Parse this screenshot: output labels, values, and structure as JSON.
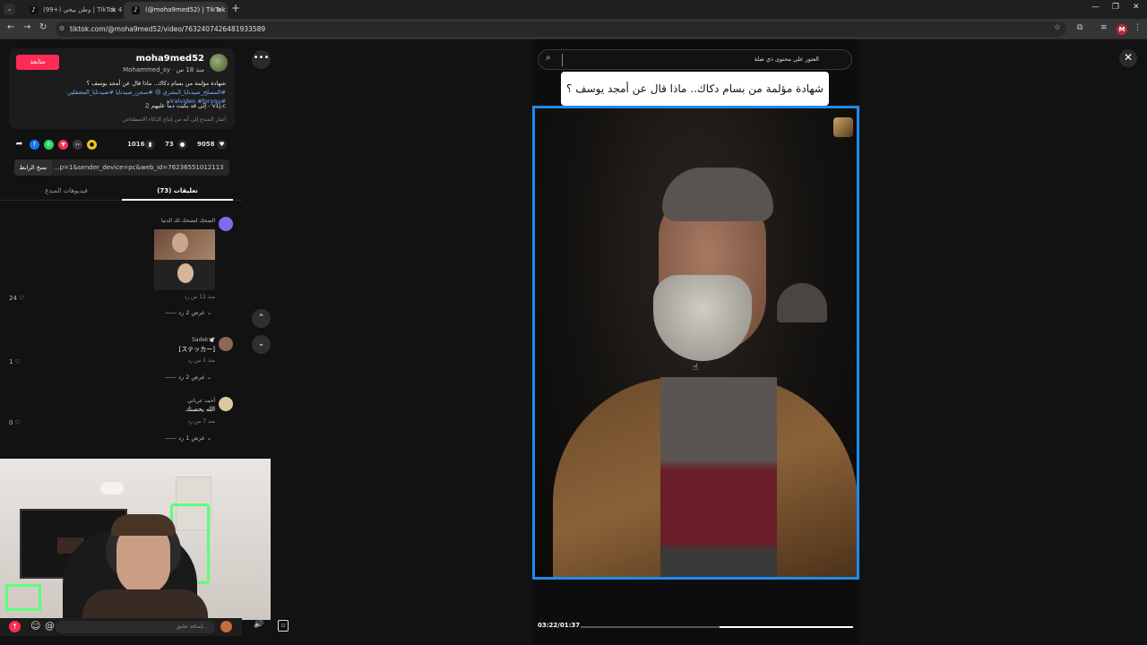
{
  "browser": {
    "tabs": [
      {
        "label": "(99+) وطن بيحي | TikTok 476",
        "active": false
      },
      {
        "label": "(@moha9med52) | TikTok · ",
        "active": true
      }
    ],
    "url": "tiktok.com/@moha9med52/video/7632407426481933589",
    "profile_initial": "M"
  },
  "post": {
    "username": "moha9med52",
    "nickname": "Mohammed_sy · منذ 18 س",
    "follow_label": "متابعة",
    "description": "شهادة مؤلمة من بسام دكاك.. ماذا قال عن أمجد يوسف ؟",
    "tags_line1": "#المسلخ_صيدنايا_البشري 😢 #سجن_صيدنايا #صيدنايا_المعتقلين",
    "tags_line2": "#viralvideo #foryou",
    "music": "إنّي قد بكيت دماً عليهم - v1j.c",
    "disclaimer": "أشار المبدع إلى أنه من إنتاج الذكاء الاصطناعي",
    "likes": "9058",
    "comments_count": "73",
    "saves": "1016",
    "link": "...p=1&sender_device=pc&web_id=7623655101211362836",
    "copy_label": "نسخ الرابط",
    "tab_comments": "(73) تعليقات",
    "tab_creator": "فيديوهات المبدع"
  },
  "comments": [
    {
      "name": "الضحك لتضحك لك الدنيا",
      "text": "",
      "meta": "منذ 11 س   رد",
      "likes": "24 ♡",
      "replies": "—— عرض 2 رد ⌄"
    },
    {
      "name": "Sadek🕊️",
      "text": "[ステッカー]",
      "meta": "منذ 1 س   رد",
      "likes": "1 ♡",
      "replies": "—— عرض 2 رد ⌄"
    },
    {
      "name": "أحمد عرباني",
      "text": "الله يحصنك",
      "meta": "منذ 7 س   رد",
      "likes": "0 ♡",
      "replies": "—— عرض 1 رد ⌄"
    }
  ],
  "comment_input_placeholder": "إضافة تعليق...",
  "search": {
    "placeholder": "العثور على محتوى ذي صلة"
  },
  "video": {
    "caption": "شهادة مؤلمة من بسام دكاك.. ماذا قال عن أمجد يوسف ؟",
    "time": "03:22/01:37",
    "progress": 0.49
  },
  "colors": {
    "accent": "#fe2c55",
    "frame": "#1e8bef"
  }
}
